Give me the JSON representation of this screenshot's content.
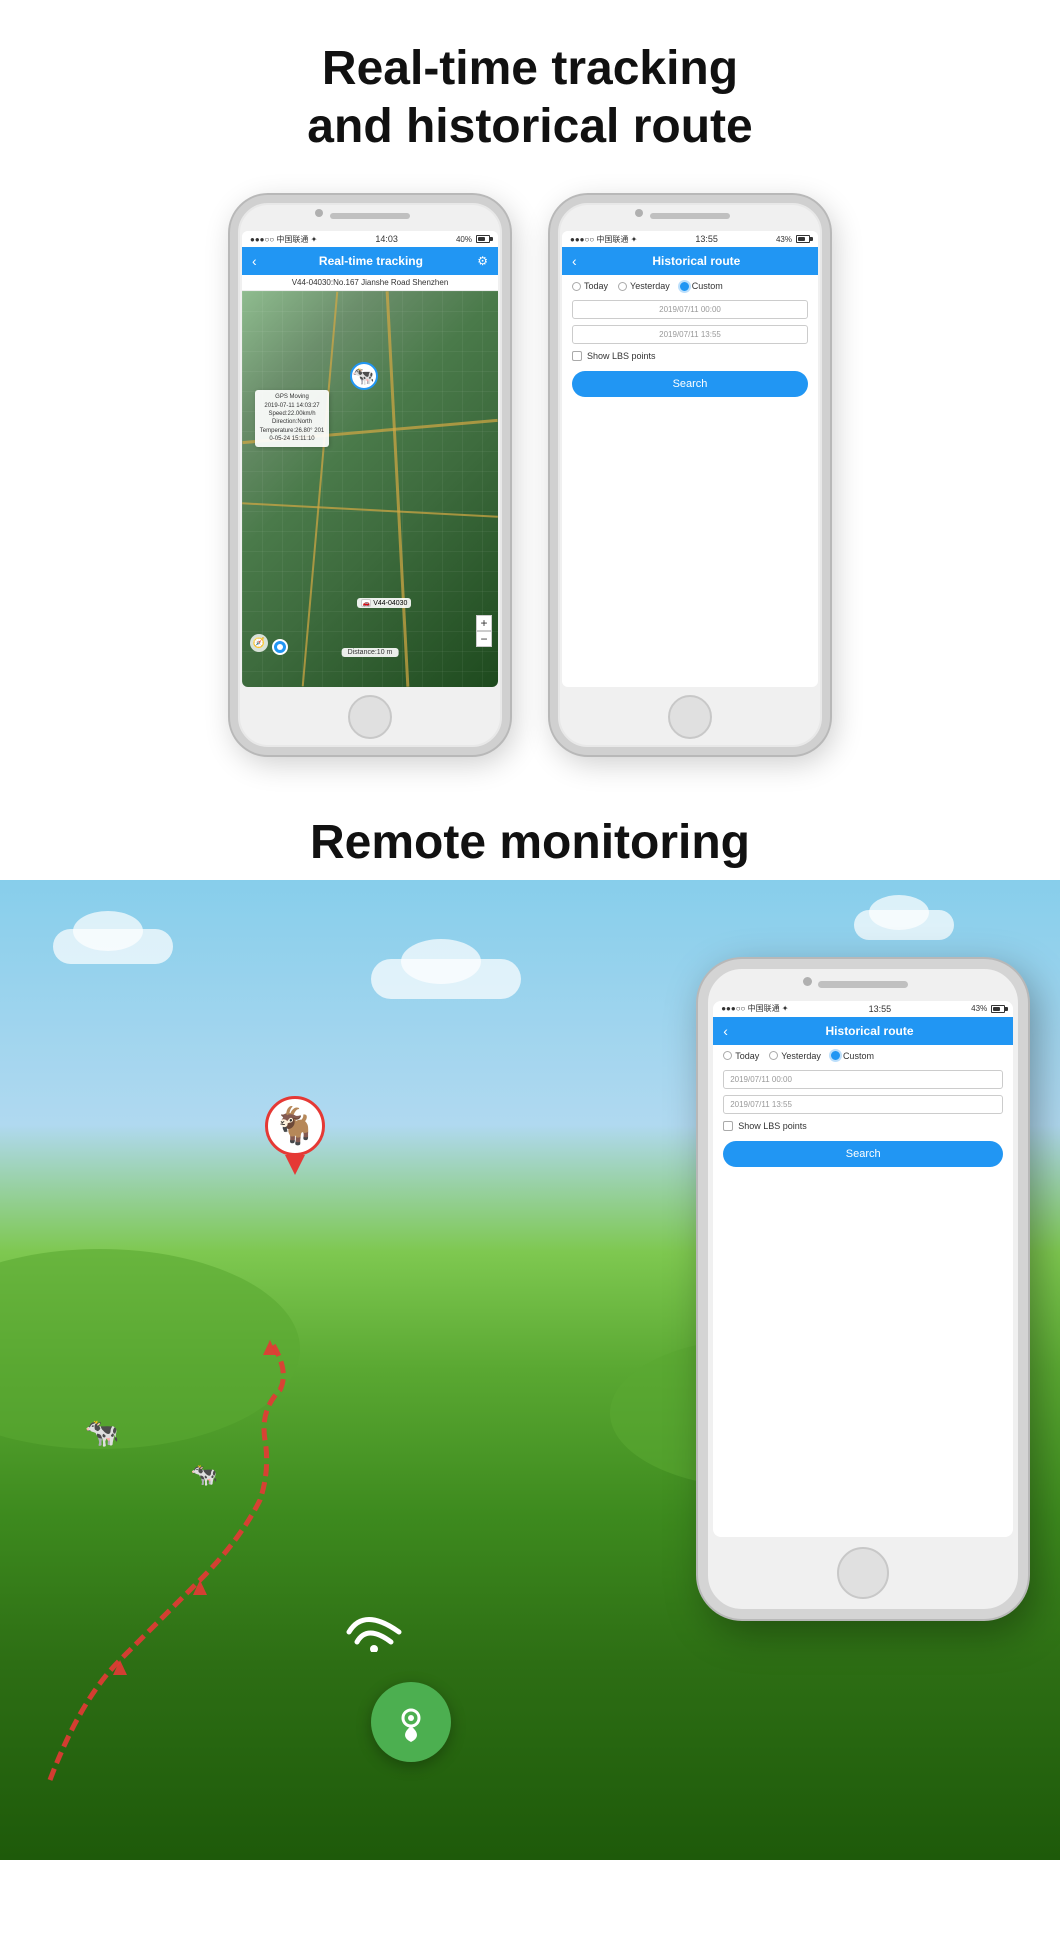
{
  "page": {
    "title": "Real-time tracking and historical route",
    "title_line1": "Real-time tracking",
    "title_line2": "and historical route",
    "section2_title": "Remote monitoring"
  },
  "phone1": {
    "status_bar": {
      "carrier": "●●●○○ 中国联通 ✦",
      "time": "14:03",
      "battery": "40%"
    },
    "header": {
      "back": "‹",
      "title": "Real-time tracking",
      "icon": "⚙"
    },
    "address": "V44-04030:No.167 Jianshe Road Shenzhen",
    "distance": "Distance:10 m",
    "gps_popup": {
      "line1": "GPS Moving",
      "line2": "2019-07-11 14:03:27",
      "line3": "Speed:22.00km/h",
      "line4": "Direction:North",
      "line5": "Temperature:26.80° 201",
      "line6": "0-05-24 15:11:10"
    },
    "vehicle_label": "V44-04030"
  },
  "phone2": {
    "status_bar": {
      "carrier": "●●●○○ 中国联通 ✦",
      "time": "13:55",
      "battery": "43%"
    },
    "header": {
      "back": "‹",
      "title": "Historical route",
      "icon": ""
    },
    "options": {
      "today": "Today",
      "yesterday": "Yesterday",
      "custom": "Custom"
    },
    "date1": "2019/07/11 00:00",
    "date2": "2019/07/11 13:55",
    "checkbox_label": "Show LBS points",
    "search_btn": "Search"
  },
  "phone_large": {
    "status_bar": {
      "carrier": "●●●○○ 中国联通 ✦",
      "time": "13:55",
      "battery": "43%"
    },
    "header": {
      "back": "‹",
      "title": "Historical route"
    },
    "options": {
      "today": "Today",
      "yesterday": "Yesterday",
      "custom": "Custom"
    },
    "date1": "2019/07/11 00:00",
    "date2": "2019/07/11 13:55",
    "checkbox_label": "Show LBS points",
    "search_btn": "Search"
  }
}
